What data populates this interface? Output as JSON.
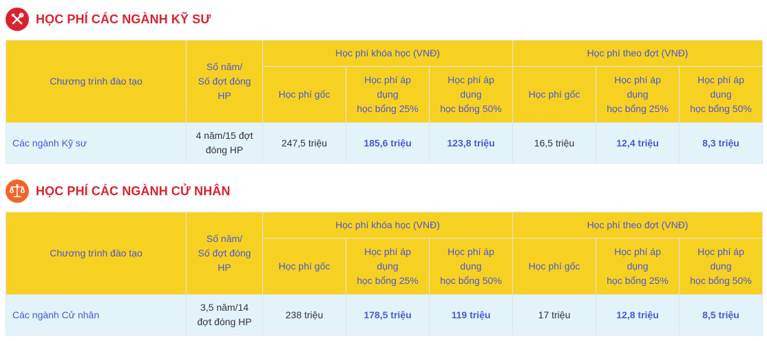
{
  "colors": {
    "heading": "#d8232f",
    "header_bg": "#f7d122",
    "header_text": "#4a57d6",
    "row_bg": "#e2f4fa",
    "icon1_bg": "#d8232f",
    "icon2_bg": "#f0662a"
  },
  "sections": [
    {
      "icon": "tools-icon",
      "title": "HỌC PHÍ CÁC NGÀNH KỸ SƯ",
      "headers": {
        "program": "Chương trình đào tạo",
        "years": "Số năm/\nSố đợt đóng\nHP",
        "course_group": "Học phí khóa học (VNĐ)",
        "term_group": "Học phí theo đợt (VNĐ)",
        "base": "Học phí gốc",
        "s25": "Học phí áp\ndụng\nhọc bổng 25%",
        "s50": "Học phí áp\ndụng\nhọc bổng 50%"
      },
      "row": {
        "program": "Các ngành Kỹ sư",
        "years": "4 năm/15 đợt\nđóng HP",
        "course_base": "247,5 triệu",
        "course_25": "185,6 triệu",
        "course_50": "123,8 triệu",
        "term_base": "16,5 triệu",
        "term_25": "12,4 triệu",
        "term_50": "8,3 triệu"
      }
    },
    {
      "icon": "scales-icon",
      "title": "HỌC PHÍ CÁC NGÀNH CỬ NHÂN",
      "headers": {
        "program": "Chương trình đào tạo",
        "years": "Số năm/\nSố đợt đóng\nHP",
        "course_group": "Học phí khóa học (VNĐ)",
        "term_group": "Học phí theo đợt (VNĐ)",
        "base": "Học phí gốc",
        "s25": "Học phí áp\ndụng\nhọc bổng 25%",
        "s50": "Học phí áp\ndụng\nhọc bổng 50%"
      },
      "row": {
        "program": "Các ngành Cử nhân",
        "years": "3,5 năm/14\nđợt đóng HP",
        "course_base": "238 triệu",
        "course_25": "178,5 triệu",
        "course_50": "119 triệu",
        "term_base": "17 triệu",
        "term_25": "12,8 triệu",
        "term_50": "8,5 triệu"
      }
    }
  ]
}
